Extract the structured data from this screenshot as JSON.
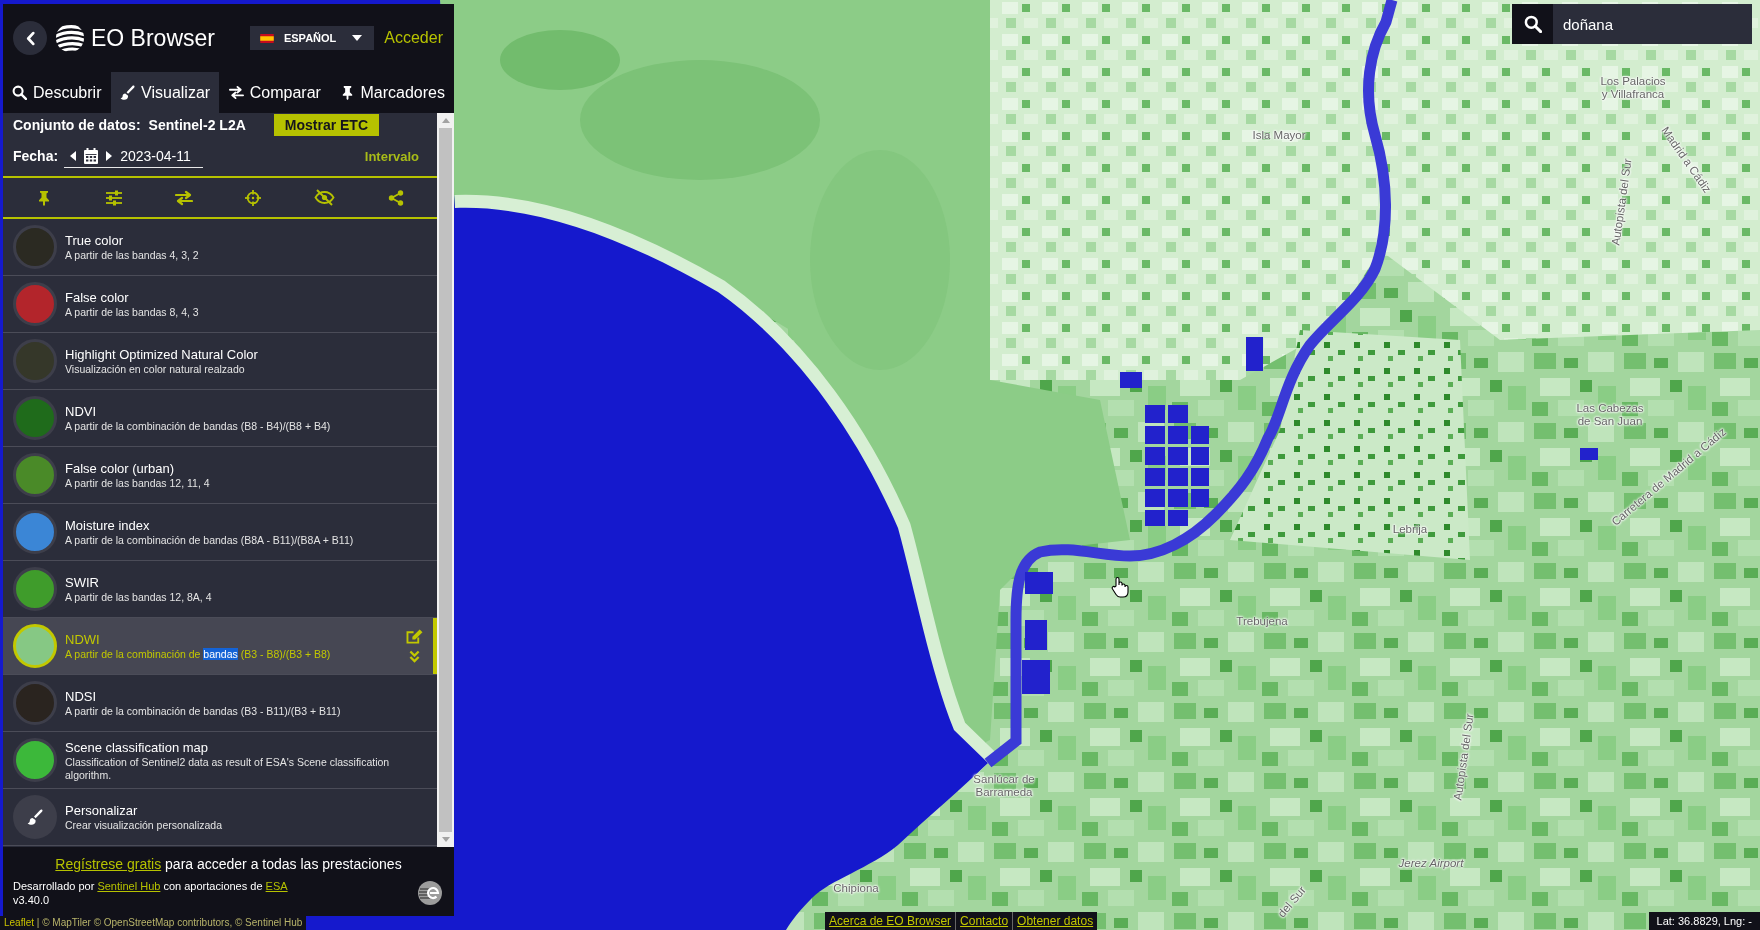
{
  "header": {
    "title": "EO Browser",
    "language": "ESPAÑOL",
    "login": "Acceder"
  },
  "tabs": [
    {
      "label": "Descubrir",
      "selected": false
    },
    {
      "label": "Visualizar",
      "selected": true
    },
    {
      "label": "Comparar",
      "selected": false
    },
    {
      "label": "Marcadores",
      "selected": false
    }
  ],
  "dataset": {
    "label": "Conjunto de datos:",
    "value": "Sentinel-2 L2A",
    "button": "Mostrar ETC"
  },
  "date": {
    "label": "Fecha:",
    "value": "2023-04-11",
    "interval": "Intervalo"
  },
  "layers": [
    {
      "kind": "preset",
      "title": "True color",
      "description": "A partir de las bandas 4, 3, 2",
      "color": "#2b2a22",
      "selected": false
    },
    {
      "kind": "preset",
      "title": "False color",
      "description": "A partir de las bandas 8, 4, 3",
      "color": "#b3252b",
      "selected": false
    },
    {
      "kind": "preset",
      "title": "Highlight Optimized Natural Color",
      "description": "Visualización en color natural realzado",
      "color": "#353729",
      "selected": false
    },
    {
      "kind": "preset",
      "title": "NDVI",
      "description": "A partir de la combinación de bandas (B8 - B4)/(B8 + B4)",
      "color": "#1f6b1b",
      "selected": false
    },
    {
      "kind": "preset",
      "title": "False color (urban)",
      "description": "A partir de las bandas 12, 11, 4",
      "color": "#4a8a28",
      "selected": false
    },
    {
      "kind": "preset",
      "title": "Moisture index",
      "description": "A partir de la combinación de bandas (B8A - B11)/(B8A + B11)",
      "color": "#3b86d6",
      "selected": false
    },
    {
      "kind": "preset",
      "title": "SWIR",
      "description": "A partir de las bandas 12, 8A, 4",
      "color": "#3f9c2b",
      "selected": false
    },
    {
      "kind": "preset",
      "title": "NDWI",
      "description_parts": [
        {
          "text": "A partir de la combinación de",
          "highlighted": false
        },
        {
          "text": "bandas",
          "highlighted": true
        },
        {
          "text": "(B3 - B8)/(B3 + B8)",
          "highlighted": false
        }
      ],
      "color": "#86c884",
      "selected": true
    },
    {
      "kind": "preset",
      "title": "NDSI",
      "description": "A partir de la combinación de bandas (B3 - B11)/(B3 + B11)",
      "color": "#2a241f",
      "selected": false
    },
    {
      "kind": "preset",
      "title": "Scene classification map",
      "description": "Classification of Sentinel2 data as result of ESA's Scene classification algorithm.",
      "color": "#3cb83a",
      "selected": false
    },
    {
      "kind": "custom",
      "title": "Personalizar",
      "description": "Crear visualización personalizada",
      "selected": false
    }
  ],
  "footer": {
    "signup": [
      {
        "text": "Regístrese gratis",
        "link": true
      },
      {
        "text": "para acceder a todas las prestaciones",
        "link": false
      }
    ],
    "credits": [
      {
        "text": "Desarrollado por",
        "link": false
      },
      {
        "text": "Sentinel Hub",
        "link": true
      },
      {
        "text": "con aportaciones de",
        "link": false
      },
      {
        "text": "ESA",
        "link": true
      }
    ],
    "version": "v3.40.0"
  },
  "search": {
    "value": "doñana"
  },
  "map_labels": [
    {
      "text": "Isla Mayor",
      "kind": "town"
    },
    {
      "text": "Los Palacios y Villafranca",
      "kind": "town"
    },
    {
      "text": "Madrid a Cádiz",
      "kind": "road"
    },
    {
      "text": "Autopista del Sur",
      "kind": "road"
    },
    {
      "text": "Las Cabezas de San Juan",
      "kind": "town"
    },
    {
      "text": "Carretera de Madrid a Cádiz",
      "kind": "road"
    },
    {
      "text": "Lebrija",
      "kind": "town"
    },
    {
      "text": "Trebujena",
      "kind": "town"
    },
    {
      "text": "Autopista del Sur",
      "kind": "road"
    },
    {
      "text": "Sanlúcar de Barrameda",
      "kind": "town"
    },
    {
      "text": "Chipiona",
      "kind": "town"
    },
    {
      "text": "Jerez Airport",
      "kind": "airport"
    },
    {
      "text": "del Sur",
      "kind": "road"
    }
  ],
  "map_links": [
    "Acerca de EO Browser",
    "Contacto",
    "Obtener datos"
  ],
  "coordinates": "Lat: 36.8829, Lng: -",
  "attribution": {
    "link": "Leaflet",
    "text": "| © MapTiler © OpenStreetMap contributors, © Sentinel Hub"
  }
}
